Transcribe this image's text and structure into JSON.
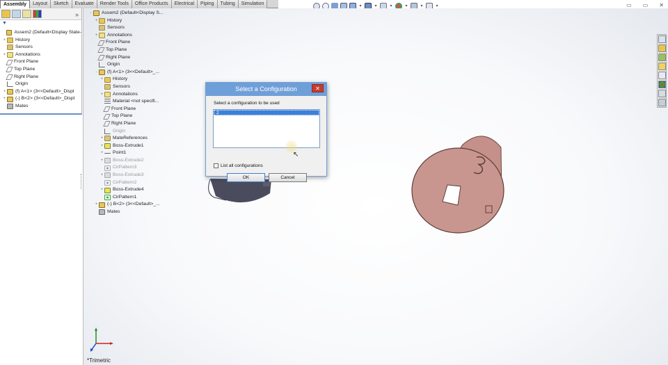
{
  "tabs": [
    {
      "label": "Assembly",
      "active": true
    },
    {
      "label": "Layout"
    },
    {
      "label": "Sketch"
    },
    {
      "label": "Evaluate"
    },
    {
      "label": "Render Tools"
    },
    {
      "label": "Office Products"
    },
    {
      "label": "Electrical"
    },
    {
      "label": "Piping"
    },
    {
      "label": "Tubing"
    },
    {
      "label": "Simulation"
    }
  ],
  "feature_manager": {
    "expand_glyph": "»",
    "filter_glyph": "▼",
    "tree": [
      {
        "label": "Assem2  (Default<Display State-",
        "icon": "assembly-icon",
        "expander": ""
      },
      {
        "label": "History",
        "icon": "folder-icon",
        "expander": "+"
      },
      {
        "label": "Sensors",
        "icon": "sensor-icon",
        "expander": ""
      },
      {
        "label": "Annotations",
        "icon": "annotation-icon",
        "expander": "+"
      },
      {
        "label": "Front Plane",
        "icon": "plane-icon",
        "expander": ""
      },
      {
        "label": "Top Plane",
        "icon": "plane-icon",
        "expander": ""
      },
      {
        "label": "Right Plane",
        "icon": "plane-icon",
        "expander": ""
      },
      {
        "label": "Origin",
        "icon": "origin-icon",
        "expander": ""
      },
      {
        "label": "(f) A<1> (3<<Default>_Displ",
        "icon": "part-icon",
        "expander": "+"
      },
      {
        "label": "(-) B<2> (3<<Default>_Displ",
        "icon": "part-icon",
        "expander": "+"
      },
      {
        "label": "Mates",
        "icon": "mates-icon",
        "expander": ""
      }
    ]
  },
  "flyout_tree": [
    {
      "label": "Assem2  (Default<Display S...",
      "icon": "assembly-icon",
      "indent": 0,
      "expander": "-"
    },
    {
      "label": "History",
      "icon": "folder-icon",
      "indent": 1,
      "expander": "+"
    },
    {
      "label": "Sensors",
      "icon": "sensor-icon",
      "indent": 1,
      "expander": ""
    },
    {
      "label": "Annotations",
      "icon": "annotation-icon",
      "indent": 1,
      "expander": "+"
    },
    {
      "label": "Front Plane",
      "icon": "plane-icon",
      "indent": 1,
      "expander": ""
    },
    {
      "label": "Top Plane",
      "icon": "plane-icon",
      "indent": 1,
      "expander": ""
    },
    {
      "label": "Right Plane",
      "icon": "plane-icon",
      "indent": 1,
      "expander": ""
    },
    {
      "label": "Origin",
      "icon": "origin-icon",
      "indent": 1,
      "expander": ""
    },
    {
      "label": "(f) A<1> (3<<Default>_...",
      "icon": "part-icon",
      "indent": 1,
      "expander": "-"
    },
    {
      "label": "History",
      "icon": "folder-icon",
      "indent": 2,
      "expander": "+"
    },
    {
      "label": "Sensors",
      "icon": "sensor-icon",
      "indent": 2,
      "expander": ""
    },
    {
      "label": "Annotations",
      "icon": "annotation-icon",
      "indent": 2,
      "expander": "+"
    },
    {
      "label": "Material <not specifi...",
      "icon": "material-icon",
      "indent": 2,
      "expander": ""
    },
    {
      "label": "Front Plane",
      "icon": "plane-icon",
      "indent": 2,
      "expander": ""
    },
    {
      "label": "Top Plane",
      "icon": "plane-icon",
      "indent": 2,
      "expander": ""
    },
    {
      "label": "Right Plane",
      "icon": "plane-icon",
      "indent": 2,
      "expander": ""
    },
    {
      "label": "Origin",
      "icon": "origin-icon",
      "indent": 2,
      "expander": "",
      "grey": true
    },
    {
      "label": "MateReferences",
      "icon": "mate-reference-icon",
      "indent": 2,
      "expander": "+"
    },
    {
      "label": "Boss-Extrude1",
      "icon": "extrude-icon",
      "indent": 2,
      "expander": "+"
    },
    {
      "label": "Point1",
      "icon": "point-icon",
      "indent": 2,
      "expander": "+"
    },
    {
      "label": "Boss-Extrude2",
      "icon": "extrude-grey-icon",
      "indent": 2,
      "expander": "+",
      "grey": true
    },
    {
      "label": "CirPattern3",
      "icon": "pattern-grey-icon",
      "indent": 2,
      "expander": "",
      "grey": true
    },
    {
      "label": "Boss-Extrude3",
      "icon": "extrude-grey-icon",
      "indent": 2,
      "expander": "+",
      "grey": true
    },
    {
      "label": "CirPattern2",
      "icon": "pattern-grey-icon",
      "indent": 2,
      "expander": "",
      "grey": true
    },
    {
      "label": "Boss-Extrude4",
      "icon": "extrude-icon",
      "indent": 2,
      "expander": "+"
    },
    {
      "label": "CirPattern1",
      "icon": "pattern-icon",
      "indent": 2,
      "expander": ""
    },
    {
      "label": "(-) B<2> (3<<Default>_...",
      "icon": "part-icon",
      "indent": 1,
      "expander": "+"
    },
    {
      "label": "Mates",
      "icon": "mates-icon",
      "indent": 1,
      "expander": ""
    }
  ],
  "dialog": {
    "title": "Select a Configuration",
    "close_glyph": "✕",
    "prompt": "Select a configuration to be used",
    "options": [
      {
        "label": "2",
        "selected": true
      }
    ],
    "list_all_label": "List all configurations",
    "list_all_checked": false,
    "ok_label": "OK",
    "cancel_label": "Cancel"
  },
  "graphics": {
    "view_label": "*Trimetric",
    "part_engraving": "3",
    "part_color": "#c9968f"
  },
  "window_controls": {
    "minimize": "▭",
    "restore": "▭",
    "close": "✕"
  },
  "colors": {
    "dialog_title": "#6f9fd8",
    "selection": "#3c80d9",
    "close_button": "#c73b2d"
  }
}
